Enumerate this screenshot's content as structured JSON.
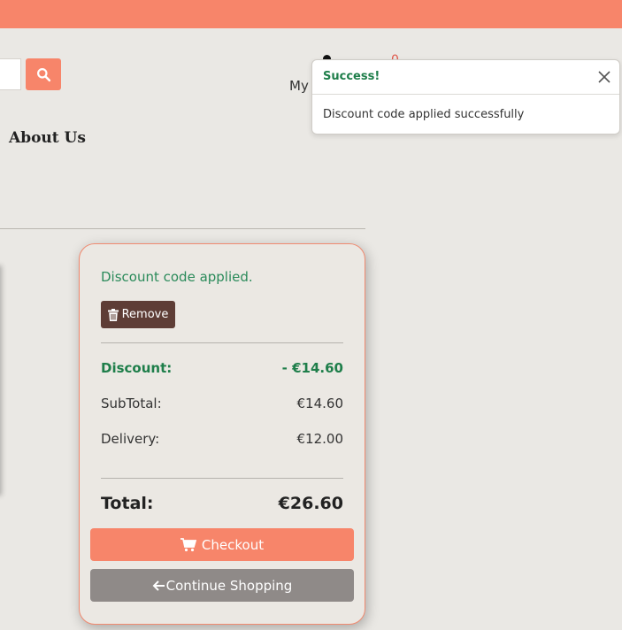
{
  "header": {
    "accent_color": "#f7856a"
  },
  "search": {
    "button_icon": "search-icon"
  },
  "account": {
    "label": "My"
  },
  "cart": {
    "count": "0"
  },
  "nav": {
    "about_label": "About Us"
  },
  "toast": {
    "title": "Success!",
    "message": "Discount code applied successfully",
    "close_icon": "close-icon"
  },
  "summary": {
    "applied_message": "Discount code applied.",
    "remove_label": "Remove",
    "discount_label": "Discount:",
    "discount_value": "- €14.60",
    "subtotal_label": "SubTotal:",
    "subtotal_value": "€14.60",
    "delivery_label": "Delivery:",
    "delivery_value": "€12.00",
    "total_label": "Total:",
    "total_value": "€26.60",
    "checkout_label": "Checkout",
    "continue_label": "Continue Shopping"
  }
}
